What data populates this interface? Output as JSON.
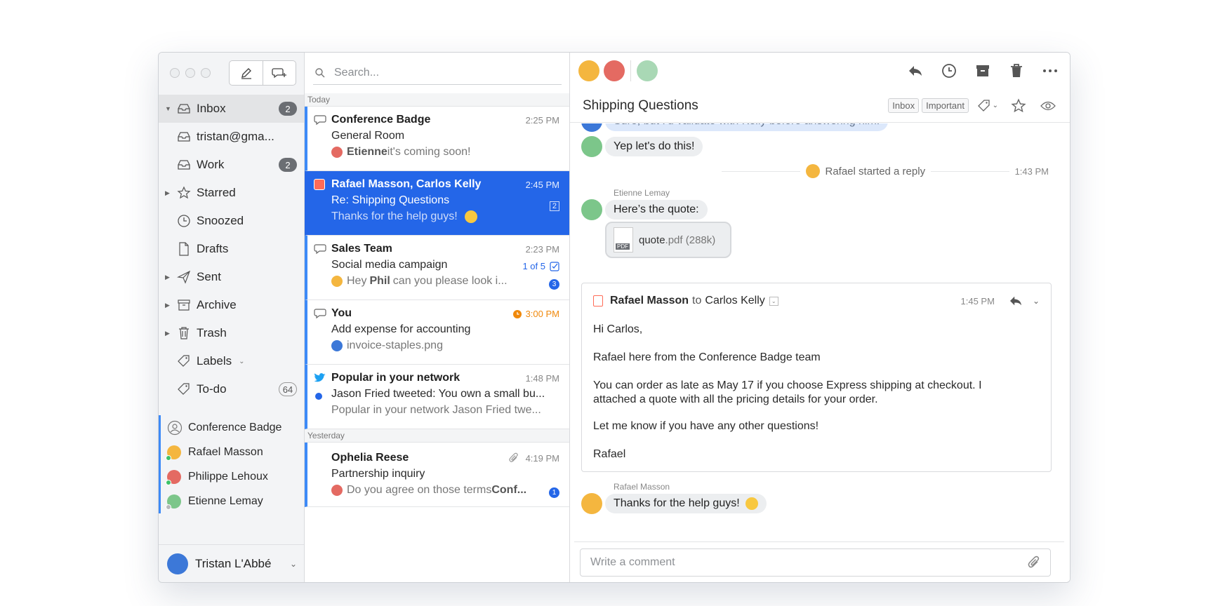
{
  "sidebar": {
    "items": [
      {
        "label": "Inbox",
        "badge": "2",
        "icon": "inbox-icon"
      },
      {
        "label": "tristan@gma...",
        "badge": "",
        "icon": "inbox-icon"
      },
      {
        "label": "Work",
        "badge": "2",
        "icon": "inbox-icon"
      },
      {
        "label": "Starred",
        "badge": "",
        "icon": "star-icon"
      },
      {
        "label": "Snoozed",
        "badge": "",
        "icon": "clock-icon"
      },
      {
        "label": "Drafts",
        "badge": "",
        "icon": "document-icon"
      },
      {
        "label": "Sent",
        "badge": "",
        "icon": "paper-plane-icon"
      },
      {
        "label": "Archive",
        "badge": "",
        "icon": "archive-box-icon"
      },
      {
        "label": "Trash",
        "badge": "",
        "icon": "trash-icon"
      },
      {
        "label": "Labels",
        "badge": "",
        "icon": "tag-icon"
      },
      {
        "label": "To-do",
        "badge": "64",
        "icon": "tag-icon"
      }
    ],
    "people": [
      "Conference Badge",
      "Rafael Masson",
      "Philippe Lehoux",
      "Etienne Lemay"
    ],
    "account_name": "Tristan L'Abbé"
  },
  "list": {
    "search_placeholder": "Search...",
    "today_label": "Today",
    "yesterday_label": "Yesterday",
    "messages": [
      {
        "from": "Conference Badge",
        "time": "2:25 PM",
        "subject": "General Room",
        "preview_bold": "Etienne",
        "preview": " it's coming soon!"
      },
      {
        "from": "Rafael Masson, Carlos Kelly",
        "time": "2:45 PM",
        "subject": "Re: Shipping Questions",
        "preview": "Thanks for the help guys!",
        "count": "2"
      },
      {
        "from": "Sales Team",
        "time": "2:23 PM",
        "subject": "Social media campaign",
        "preview_a": "Hey ",
        "preview_bold": "Phil",
        "preview_b": " can you please look i...",
        "todo": "1 of 5",
        "unread": "3"
      },
      {
        "from": "You",
        "time": "3:00 PM",
        "subject": "Add expense for accounting",
        "preview": "invoice-staples.png"
      },
      {
        "from": "Popular in your network",
        "time": "1:48 PM",
        "subject": "Jason Fried tweeted: You own a small bu...",
        "preview": "Popular in your network Jason Fried twe..."
      },
      {
        "from": "Ophelia Reese",
        "time": "4:19 PM",
        "subject": "Partnership inquiry",
        "preview": "Do you agree on those terms ",
        "preview_bold": "Conf...",
        "unread": "1"
      }
    ]
  },
  "thread": {
    "subject": "Shipping Questions",
    "tags": [
      "Inbox",
      "Important"
    ],
    "cut_bubble": "Sure, but I'd validate with Kelly before answering him.",
    "bubble1": "Yep let's do this!",
    "reply_notice": "Rafael started a reply",
    "reply_time": "1:43 PM",
    "etienne_name": "Etienne Lemay",
    "etienne_msg": "Here’s the quote:",
    "attachment_name": "quote",
    "attachment_ext": ".pdf (288k)",
    "attachment_badge": "PDF",
    "email": {
      "from": "Rafael Masson",
      "to_word": "to",
      "to": "Carlos Kelly",
      "time": "1:45 PM",
      "greeting": "Hi Carlos,",
      "p1": "Rafael here from the Conference Badge team",
      "p2": "You can order as late as May 17 if you choose Express shipping at checkout. I attached a quote with all the pricing details for your order.",
      "p3": "Let me know if you have any other questions!",
      "sign": "Rafael"
    },
    "rafael_name": "Rafael Masson",
    "rafael_msg": "Thanks for the help guys!",
    "composer_placeholder": "Write a comment"
  },
  "colors": {
    "accent": "#2466e8",
    "indicator": "#3d8af7",
    "orange": "#f5a623",
    "twitter": "#1da1f2"
  }
}
